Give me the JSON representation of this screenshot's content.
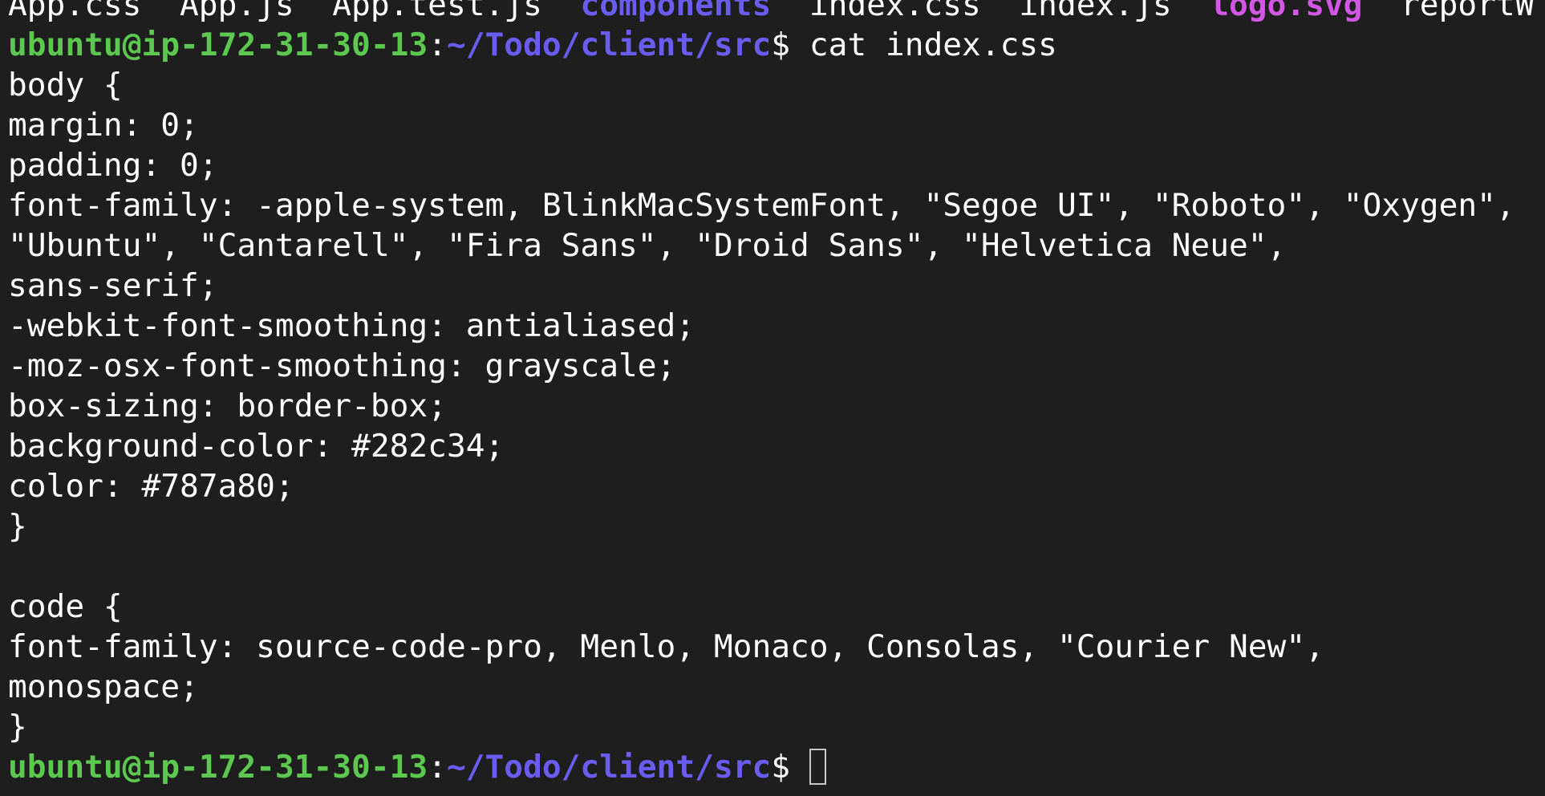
{
  "terminal": {
    "ls_output": [
      {
        "text": "App.css",
        "type": "file"
      },
      {
        "text": "App.js",
        "type": "file"
      },
      {
        "text": "App.test.js",
        "type": "file"
      },
      {
        "text": "components",
        "type": "dir"
      },
      {
        "text": "index.css",
        "type": "file"
      },
      {
        "text": "index.js",
        "type": "file"
      },
      {
        "text": "logo.svg",
        "type": "svg"
      },
      {
        "text": "reportW",
        "type": "file"
      }
    ],
    "prompt": {
      "user_host": "ubuntu@ip-172-31-30-13",
      "colon": ":",
      "path": "~/Todo/client/src",
      "symbol": "$ "
    },
    "command": "cat index.css",
    "output_lines": [
      "body {",
      "margin: 0;",
      "padding: 0;",
      "font-family: -apple-system, BlinkMacSystemFont, \"Segoe UI\", \"Roboto\", \"Oxygen\",",
      "\"Ubuntu\", \"Cantarell\", \"Fira Sans\", \"Droid Sans\", \"Helvetica Neue\",",
      "sans-serif;",
      "-webkit-font-smoothing: antialiased;",
      "-moz-osx-font-smoothing: grayscale;",
      "box-sizing: border-box;",
      "background-color: #282c34;",
      "color: #787a80;",
      "}",
      "",
      "code {",
      "font-family: source-code-pro, Menlo, Monaco, Consolas, \"Courier New\",",
      "monospace;",
      "}"
    ],
    "colors": {
      "background": "#1e1e1e",
      "text": "#ffffff",
      "prompt_user": "#5cc84f",
      "prompt_path": "#6b5cf0",
      "ls_dir": "#6b5cf0",
      "ls_svg": "#d357e5"
    }
  }
}
